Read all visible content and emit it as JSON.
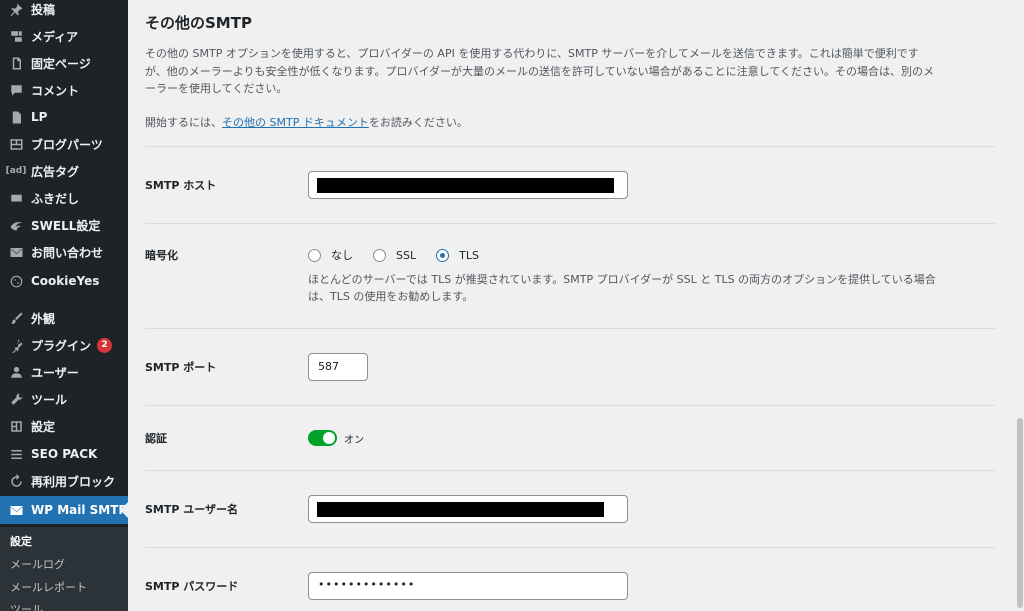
{
  "sidebar": {
    "items": [
      {
        "label": "投稿",
        "icon": "pin-icon"
      },
      {
        "label": "メディア",
        "icon": "media-icon"
      },
      {
        "label": "固定ページ",
        "icon": "page-icon"
      },
      {
        "label": "コメント",
        "icon": "comment-icon"
      },
      {
        "label": "LP",
        "icon": "document-icon"
      },
      {
        "label": "ブログパーツ",
        "icon": "grid-icon"
      },
      {
        "label": "広告タグ",
        "icon": "ad-icon"
      },
      {
        "label": "ふきだし",
        "icon": "bubble-icon"
      },
      {
        "label": "SWELL設定",
        "icon": "swell-icon"
      },
      {
        "label": "お問い合わせ",
        "icon": "mail-icon"
      },
      {
        "label": "CookieYes",
        "icon": "cookie-icon"
      },
      {
        "label": "外観",
        "icon": "brush-icon"
      },
      {
        "label": "プラグイン",
        "icon": "plugin-icon",
        "badge": "2"
      },
      {
        "label": "ユーザー",
        "icon": "user-icon"
      },
      {
        "label": "ツール",
        "icon": "wrench-icon"
      },
      {
        "label": "設定",
        "icon": "settings-icon"
      },
      {
        "label": "SEO PACK",
        "icon": "list-icon"
      },
      {
        "label": "再利用ブロック",
        "icon": "reuse-icon"
      },
      {
        "label": "WP Mail SMTP",
        "icon": "wpmail-icon",
        "active": true
      }
    ],
    "submenu": [
      "設定",
      "メールログ",
      "メールレポート",
      "ツール"
    ]
  },
  "section": {
    "title": "その他のSMTP",
    "desc_line1": "その他の SMTP オプションを使用すると、プロバイダーの API を使用する代わりに、SMTP サーバーを介してメールを送信できます。これは簡単で便利です",
    "desc_line2": "が、他のメーラーよりも安全性が低くなります。プロバイダーが大量のメールの送信を許可していない場合があることに注意してください。その場合は、別のメ",
    "desc_line3": "ーラーを使用してください。",
    "start_prefix": "開始するには、",
    "doc_link": "その他の SMTP ドキュメント",
    "start_suffix": "をお読みください。"
  },
  "fields": {
    "host_label": "SMTP ホスト",
    "encryption_label": "暗号化",
    "encryption_options": [
      "なし",
      "SSL",
      "TLS"
    ],
    "encryption_selected": "TLS",
    "encryption_hint1": "ほとんどのサーバーでは TLS が推奨されています。SMTP プロバイダーが SSL と TLS の両方のオプションを提供している場合",
    "encryption_hint2": "は、TLS の使用をお勧めします。",
    "port_label": "SMTP ポート",
    "port_value": "587",
    "auth_label": "認証",
    "auth_state": "オン",
    "username_label": "SMTP ユーザー名",
    "password_label": "SMTP パスワード",
    "password_value": "•••••••••••••"
  },
  "colors": {
    "accent": "#2271b1",
    "toggle_on": "#00a32a",
    "badge": "#d63638"
  }
}
